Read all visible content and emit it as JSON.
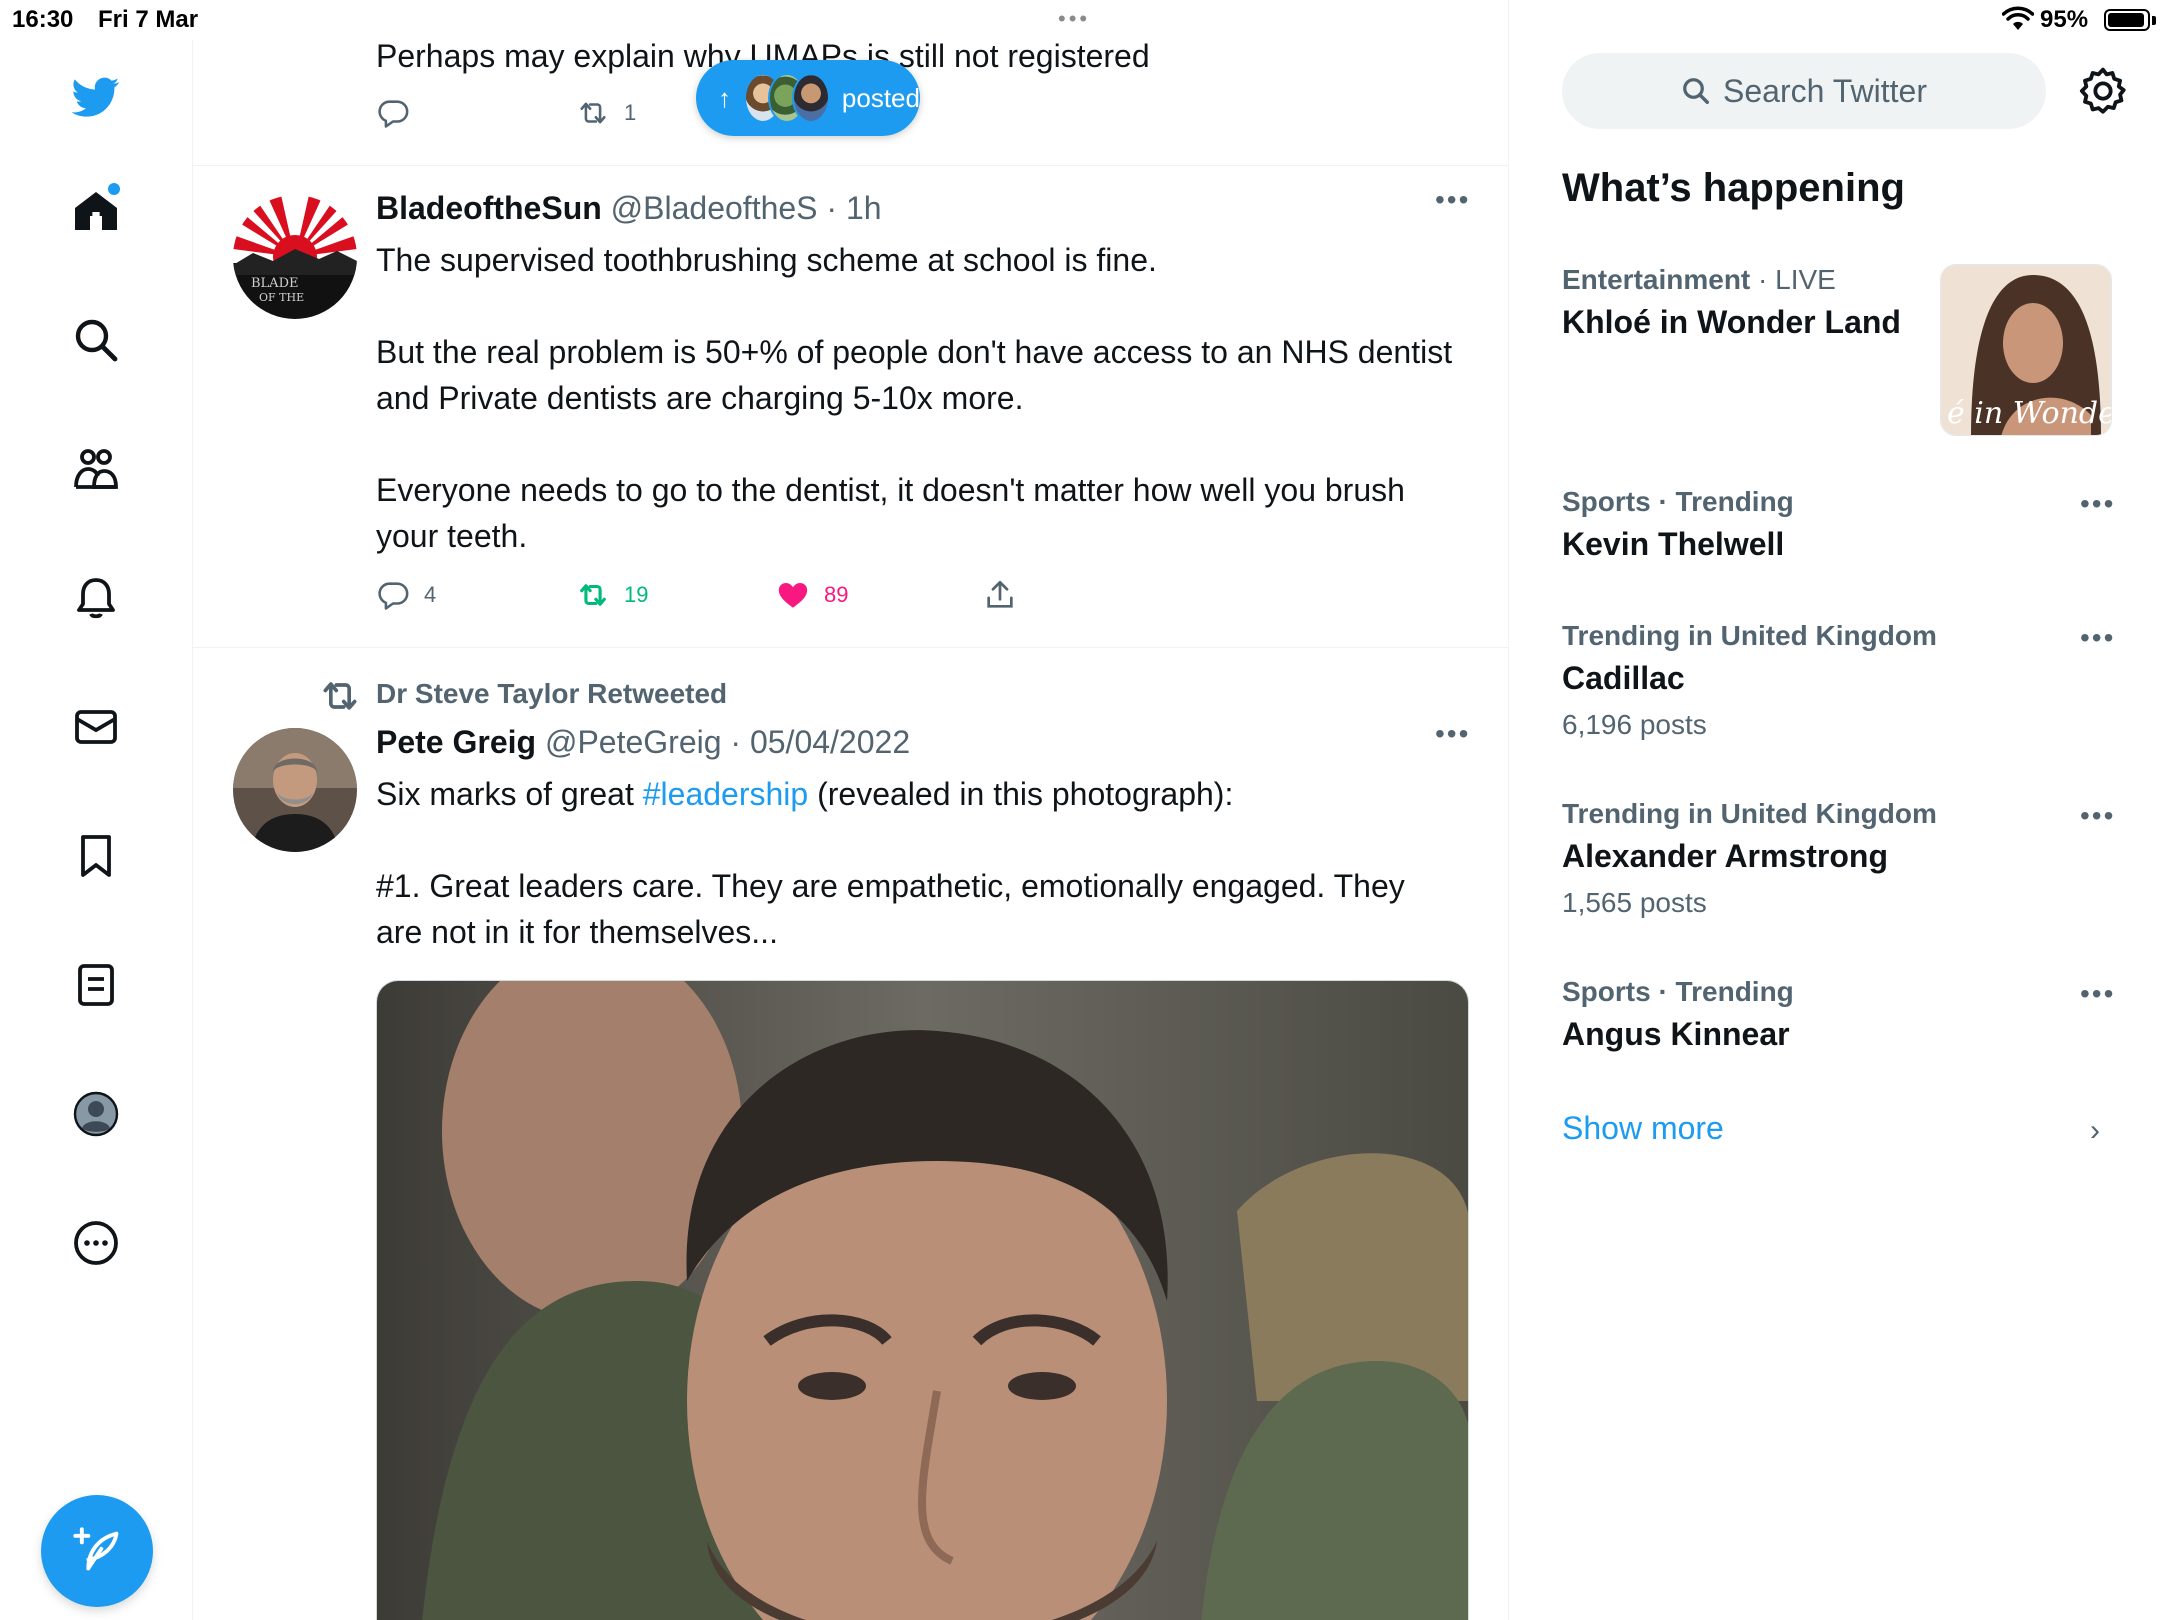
{
  "status_bar": {
    "time": "16:30",
    "date": "Fri 7 Mar",
    "multitask_dots": "•••",
    "battery": "95%"
  },
  "nav": {
    "items": [
      "twitter-logo",
      "home-icon",
      "search-icon",
      "communities-icon",
      "notifications-icon",
      "messages-icon",
      "bookmarks-icon",
      "lists-icon",
      "profile-icon",
      "more-icon"
    ],
    "compose_icon": "compose-icon"
  },
  "timeline": {
    "tweet_top": {
      "text": "Perhaps may explain why UMAPs is still not registered",
      "retweets": "1"
    },
    "new_posts_pill": {
      "label": "posted"
    },
    "tweets": [
      {
        "name": "BladeoftheSun",
        "handle": "@BladeoftheS",
        "time": "· 1h",
        "body": [
          "The supervised toothbrushing scheme at school is fine.",
          "But the real problem is 50+% of people don't have access to an NHS dentist and Private dentists are charging 5-10x more.",
          "Everyone needs to go to the dentist, it doesn't matter how well you brush your teeth."
        ],
        "replies": "4",
        "retweets": "19",
        "likes": "89"
      },
      {
        "retweeted_by": "Dr Steve Taylor Retweeted",
        "name": "Pete Greig",
        "handle": "@PeteGreig",
        "time": "· 05/04/2022",
        "body_prefix": "Six marks of great ",
        "hashtag": "#leadership",
        "body_suffix": " (revealed in this photograph):",
        "body_2": "#1. Great leaders care. They are empathetic, emotionally engaged. They are not in it for themselves..."
      }
    ]
  },
  "sidebar": {
    "search_placeholder": "Search Twitter",
    "section_title": "What’s happening",
    "trends": [
      {
        "category": "Entertainment",
        "qualifier": "· LIVE",
        "name": "Khloé in Wonder Land",
        "count": ""
      },
      {
        "category": "Sports · Trending",
        "qualifier": "",
        "name": "Kevin Thelwell",
        "count": ""
      },
      {
        "category": "Trending in United Kingdom",
        "qualifier": "",
        "name": "Cadillac",
        "count": "6,196 posts"
      },
      {
        "category": "Trending in United Kingdom",
        "qualifier": "",
        "name": "Alexander Armstrong",
        "count": "1,565 posts"
      },
      {
        "category": "Sports · Trending",
        "qualifier": "",
        "name": "Angus Kinnear",
        "count": ""
      }
    ],
    "trend_image_caption": "é in Wonder L",
    "show_more": "Show more"
  },
  "colors": {
    "accent": "#1d9bf0",
    "secondary_text": "#536471",
    "retweet_green": "#00ba7c",
    "like_pink": "#f91880"
  }
}
